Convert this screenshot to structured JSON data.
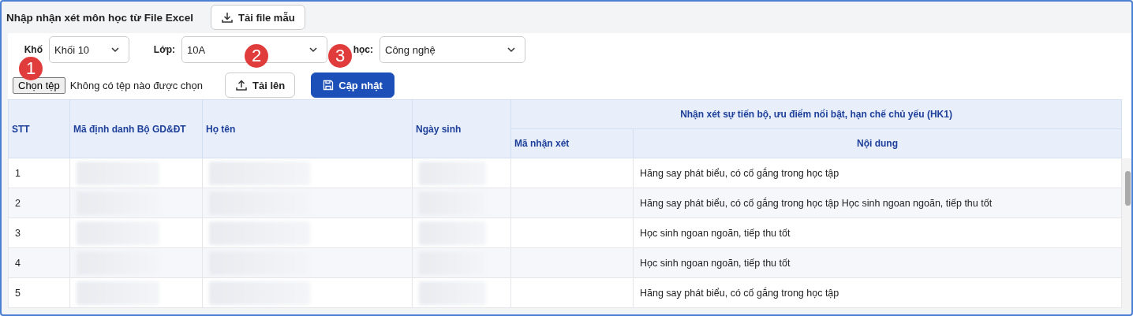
{
  "title": "Nhập nhận xét môn học từ File Excel",
  "template_button": "Tải file mẫu",
  "filters": [
    {
      "label": "Khố",
      "value": "Khối 10"
    },
    {
      "label": "Lớp:",
      "value": "10A"
    },
    {
      "label": "học:",
      "value": "Công nghệ"
    }
  ],
  "file_picker": {
    "button": "Chọn tệp",
    "status": "Không có tệp nào được chọn"
  },
  "upload_button": "Tải lên",
  "update_button": "Cập nhật",
  "step_badges": [
    "1",
    "2",
    "3"
  ],
  "table": {
    "columns": [
      "STT",
      "Mã định danh Bộ GD&ĐT",
      "Họ tên",
      "Ngày sinh"
    ],
    "group_header": "Nhận xét sự tiến bộ, ưu điểm nổi bật, hạn chế chủ yếu (HK1)",
    "sub_columns": [
      "Mã nhận xét",
      "Nội dung"
    ],
    "rows": [
      {
        "stt": "1",
        "content": "Hăng say phát biểu, có cố gắng trong học tập"
      },
      {
        "stt": "2",
        "content": "Hăng say phát biểu, có cố gắng trong học tập Học sinh ngoan ngoãn, tiếp thu tốt"
      },
      {
        "stt": "3",
        "content": "Học sinh ngoan ngoãn, tiếp thu tốt"
      },
      {
        "stt": "4",
        "content": "Học sinh ngoan ngoãn, tiếp thu tốt"
      },
      {
        "stt": "5",
        "content": "Hăng say phát biểu, có cố gắng trong học tập"
      }
    ]
  }
}
